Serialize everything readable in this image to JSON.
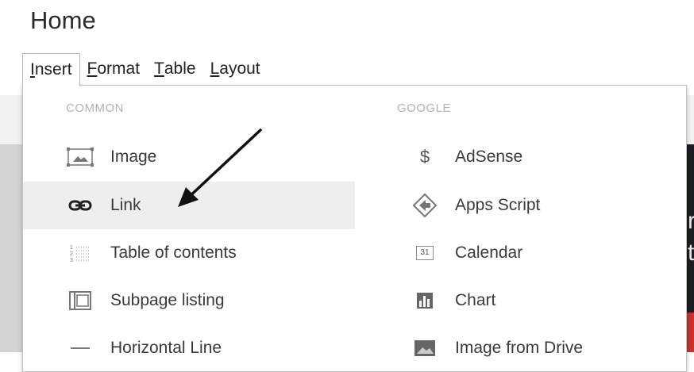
{
  "page": {
    "title": "Home"
  },
  "menubar": [
    {
      "label": "Insert",
      "mnemonic": "I",
      "rest": "nsert",
      "active": true
    },
    {
      "label": "Format",
      "mnemonic": "F",
      "rest": "ormat",
      "active": false
    },
    {
      "label": "Table",
      "mnemonic": "T",
      "rest": "able",
      "active": false
    },
    {
      "label": "Layout",
      "mnemonic": "L",
      "rest": "ayout",
      "active": false
    }
  ],
  "dropdown": {
    "common": {
      "heading": "COMMON",
      "items": [
        {
          "label": "Image",
          "icon": "image-icon"
        },
        {
          "label": "Link",
          "icon": "link-icon",
          "highlighted": true
        },
        {
          "label": "Table of contents",
          "icon": "table-of-contents-icon"
        },
        {
          "label": "Subpage listing",
          "icon": "subpage-listing-icon"
        },
        {
          "label": "Horizontal Line",
          "icon": "horizontal-line-icon"
        }
      ]
    },
    "google": {
      "heading": "GOOGLE",
      "items": [
        {
          "label": "AdSense",
          "icon": "dollar-icon",
          "glyph": "$"
        },
        {
          "label": "Apps Script",
          "icon": "apps-script-icon"
        },
        {
          "label": "Calendar",
          "icon": "calendar-icon",
          "glyph": "31"
        },
        {
          "label": "Chart",
          "icon": "chart-icon"
        },
        {
          "label": "Image from Drive",
          "icon": "drive-image-icon"
        }
      ]
    }
  },
  "background": {
    "peek_letters": [
      "r",
      "t"
    ]
  },
  "colors": {
    "highlight": "#eeeeee",
    "heading": "#b3b3b3",
    "border": "#c3c3c3"
  }
}
